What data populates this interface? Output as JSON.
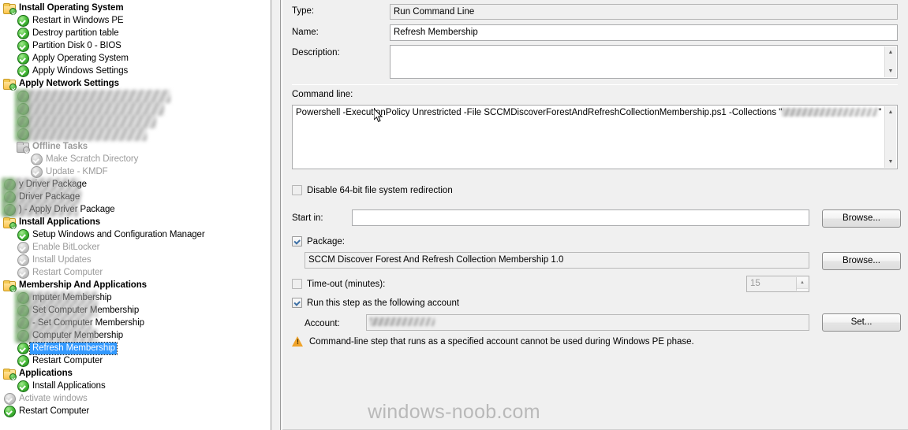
{
  "tree": {
    "items": [
      {
        "label": "Install Operating System",
        "level": 0,
        "icon": "folder-check-icon",
        "kind": "group",
        "state": "enabled"
      },
      {
        "label": "Restart in Windows PE",
        "level": 1,
        "icon": "green-check-icon",
        "kind": "step",
        "state": "enabled"
      },
      {
        "label": "Destroy partition table",
        "level": 1,
        "icon": "green-check-icon",
        "kind": "step",
        "state": "enabled"
      },
      {
        "label": "Partition Disk 0 - BIOS",
        "level": 1,
        "icon": "green-check-icon",
        "kind": "step",
        "state": "enabled"
      },
      {
        "label": "Apply Operating System",
        "level": 1,
        "icon": "green-check-icon",
        "kind": "step",
        "state": "enabled"
      },
      {
        "label": "Apply Windows Settings",
        "level": 1,
        "icon": "green-check-icon",
        "kind": "step",
        "state": "enabled"
      },
      {
        "label": "Apply Network Settings",
        "level": 0,
        "icon": "folder-check-icon",
        "kind": "group",
        "state": "enabled"
      },
      {
        "label": "",
        "level": 1,
        "icon": "green-check-icon",
        "kind": "step",
        "state": "redacted",
        "blur_width": 196
      },
      {
        "label": "",
        "level": 1,
        "icon": "green-check-icon",
        "kind": "step",
        "state": "redacted",
        "blur_width": 188
      },
      {
        "label": "",
        "level": 1,
        "icon": "green-check-icon",
        "kind": "step",
        "state": "redacted",
        "blur_width": 178
      },
      {
        "label": "",
        "level": 1,
        "icon": "green-check-icon",
        "kind": "step",
        "state": "redacted",
        "blur_width": 166
      },
      {
        "label": "Offline  Tasks",
        "level": 1,
        "icon": "folder-check-icon",
        "kind": "group",
        "state": "disabled"
      },
      {
        "label": "Make Scratch Directory",
        "level": 2,
        "icon": "green-check-icon",
        "kind": "step",
        "state": "disabled"
      },
      {
        "label": "Update - KMDF",
        "level": 2,
        "icon": "green-check-icon",
        "kind": "step",
        "state": "disabled"
      },
      {
        "label": "y Driver Package",
        "level": 0,
        "icon": "green-check-icon",
        "kind": "step",
        "state": "partial-redacted",
        "blur_width": 98
      },
      {
        "label": "Driver Package",
        "level": 0,
        "icon": "green-check-icon",
        "kind": "step",
        "state": "partial-redacted",
        "blur_width": 100
      },
      {
        "label": ") - Apply Driver Package",
        "level": 0,
        "icon": "green-check-icon",
        "kind": "step",
        "state": "partial-redacted",
        "blur_width": 96
      },
      {
        "label": "Install Applications",
        "level": 0,
        "icon": "folder-check-icon",
        "kind": "group",
        "state": "enabled"
      },
      {
        "label": "Setup Windows and Configuration Manager",
        "level": 1,
        "icon": "green-check-icon",
        "kind": "step",
        "state": "enabled"
      },
      {
        "label": "Enable BitLocker",
        "level": 1,
        "icon": "green-check-icon",
        "kind": "step",
        "state": "disabled"
      },
      {
        "label": "Install Updates",
        "level": 1,
        "icon": "green-check-icon",
        "kind": "step",
        "state": "disabled"
      },
      {
        "label": "Restart Computer",
        "level": 1,
        "icon": "green-check-icon",
        "kind": "step",
        "state": "disabled"
      },
      {
        "label": "Membership And Applications",
        "level": 0,
        "icon": "folder-check-icon",
        "kind": "group",
        "state": "enabled"
      },
      {
        "label": "mputer Membership",
        "level": 1,
        "icon": "green-check-icon",
        "kind": "step",
        "state": "partial-redacted",
        "blur_width": 104
      },
      {
        "label": "Set Computer Membership",
        "level": 1,
        "icon": "green-check-icon",
        "kind": "step",
        "state": "partial-redacted",
        "blur_width": 104
      },
      {
        "label": "- Set Computer Membership",
        "level": 1,
        "icon": "green-check-icon",
        "kind": "step",
        "state": "partial-redacted",
        "blur_width": 96
      },
      {
        "label": "Computer Membership",
        "level": 1,
        "icon": "green-check-icon",
        "kind": "step",
        "state": "partial-redacted",
        "blur_width": 104
      },
      {
        "label": "Refresh Membership",
        "level": 1,
        "icon": "green-check-icon",
        "kind": "step",
        "state": "selected"
      },
      {
        "label": "Restart Computer",
        "level": 1,
        "icon": "green-check-icon",
        "kind": "step",
        "state": "enabled"
      },
      {
        "label": "Applications",
        "level": 0,
        "icon": "folder-check-icon",
        "kind": "group",
        "state": "enabled"
      },
      {
        "label": "Install Applications",
        "level": 1,
        "icon": "green-check-icon",
        "kind": "step",
        "state": "enabled"
      },
      {
        "label": "Activate windows",
        "level": 0,
        "icon": "green-check-icon",
        "kind": "step",
        "state": "disabled"
      },
      {
        "label": "Restart Computer",
        "level": 0,
        "icon": "green-check-icon",
        "kind": "step",
        "state": "enabled"
      }
    ]
  },
  "properties": {
    "type_label": "Type:",
    "type_value": "Run Command Line",
    "name_label": "Name:",
    "name_value": "Refresh Membership",
    "description_label": "Description:",
    "description_value": "",
    "command_line_label": "Command line:",
    "command_line_value": "Powershell -ExecutionPolicy Unrestricted -File SCCMDiscoverForestAndRefreshCollectionMembership.ps1 -Collections \"",
    "command_line_value_tail": "\"",
    "disable_redirection_label": "Disable 64-bit file system redirection",
    "disable_redirection_checked": false,
    "start_in_label": "Start in:",
    "start_in_value": "",
    "start_in_browse_label": "Browse...",
    "package_label": "Package:",
    "package_checked": true,
    "package_value": "SCCM Discover Forest And Refresh Collection Membership 1.0",
    "package_browse_label": "Browse...",
    "timeout_label": "Time-out (minutes):",
    "timeout_checked": false,
    "timeout_value": "15",
    "run_as_label": "Run this step as the following account",
    "run_as_checked": true,
    "account_label": "Account:",
    "account_value": "",
    "account_set_label": "Set...",
    "warning_text": "Command-line step that runs as a specified account cannot be used during Windows PE phase."
  },
  "watermark": "windows-noob.com",
  "colors": {
    "selection": "#3399ff",
    "panel_background": "#f0f0f0",
    "tree_background": "#ffffff",
    "warning": "#f0a32a",
    "check_green": "#2e9b27"
  }
}
